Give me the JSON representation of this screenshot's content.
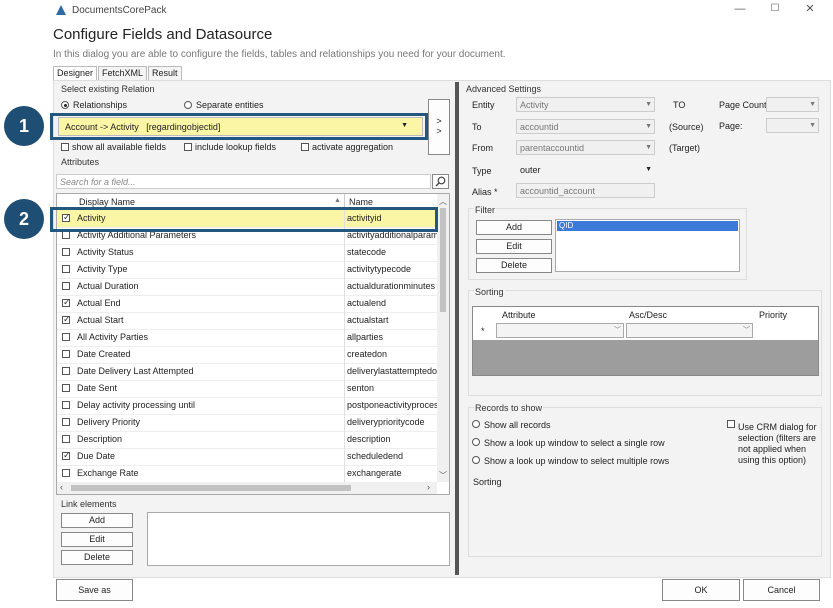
{
  "window": {
    "title": "DocumentsCorePack"
  },
  "dialog": {
    "title": "Configure Fields and Datasource",
    "subtitle": "In this dialog you are able to configure the fields, tables and relationships you need for your document."
  },
  "tabs": [
    "Designer",
    "FetchXML",
    "Result"
  ],
  "relation": {
    "group_label": "Select existing Relation",
    "radio_relationships": "Relationships",
    "radio_separate": "Separate entities",
    "selected": "Account -> Activity   [regardingobjectid]",
    "side_button": ">\n>",
    "chk_show_all": "show all available fields",
    "chk_lookup": "include lookup fields",
    "chk_aggregation": "activate aggregation"
  },
  "attributes": {
    "group_label": "Attributes",
    "search_placeholder": "Search for a field...",
    "col_display": "Display Name",
    "col_name": "Name",
    "rows": [
      {
        "display": "Activity",
        "name": "activityid",
        "checked": true
      },
      {
        "display": "Activity Additional Parameters",
        "name": "activityadditionalparams",
        "checked": false
      },
      {
        "display": "Activity Status",
        "name": "statecode",
        "checked": false
      },
      {
        "display": "Activity Type",
        "name": "activitytypecode",
        "checked": false
      },
      {
        "display": "Actual Duration",
        "name": "actualdurationminutes",
        "checked": false
      },
      {
        "display": "Actual End",
        "name": "actualend",
        "checked": true
      },
      {
        "display": "Actual Start",
        "name": "actualstart",
        "checked": true
      },
      {
        "display": "All Activity Parties",
        "name": "allparties",
        "checked": false
      },
      {
        "display": "Date Created",
        "name": "createdon",
        "checked": false
      },
      {
        "display": "Date Delivery Last Attempted",
        "name": "deliverylastattemptedon",
        "checked": false
      },
      {
        "display": "Date Sent",
        "name": "senton",
        "checked": false
      },
      {
        "display": "Delay activity processing until",
        "name": "postponeactivityprocessinguntil",
        "checked": false
      },
      {
        "display": "Delivery Priority",
        "name": "deliveryprioritycode",
        "checked": false
      },
      {
        "display": "Description",
        "name": "description",
        "checked": false
      },
      {
        "display": "Due Date",
        "name": "scheduledend",
        "checked": true
      },
      {
        "display": "Exchange Rate",
        "name": "exchangerate",
        "checked": false
      }
    ]
  },
  "link_elements": {
    "group_label": "Link elements",
    "add": "Add",
    "edit": "Edit",
    "delete": "Delete"
  },
  "advanced": {
    "group_label": "Advanced Settings",
    "entity_label": "Entity",
    "entity_value": "Activity",
    "to_label": "To",
    "to_value": "accountid",
    "to_hint": "(Source)",
    "from_label": "From",
    "from_value": "parentaccountid",
    "from_hint": "(Target)",
    "type_label": "Type",
    "type_value": "outer",
    "alias_label": "Alias *",
    "alias_value": "accountid_account",
    "TO_label": "TO",
    "page_count_label": "Page Count:",
    "page_label": "Page:"
  },
  "filter": {
    "group_label": "Filter",
    "add": "Add",
    "edit": "Edit",
    "delete": "Delete",
    "item": "QID"
  },
  "sorting": {
    "group_label": "Sorting",
    "col_attribute": "Attribute",
    "col_ascdesc": "Asc/Desc",
    "col_priority": "Priority",
    "row_marker": "*"
  },
  "records": {
    "group_label": "Records to show",
    "opt_all": "Show all records",
    "opt_single": "Show a look up window to select a single row",
    "opt_multiple": "Show a look up window to select multiple rows",
    "use_crm": "Use CRM dialog for selection (filters are not applied when using this option)",
    "sorting_label": "Sorting"
  },
  "footer": {
    "save_as": "Save as",
    "ok": "OK",
    "cancel": "Cancel"
  },
  "badges": [
    "1",
    "2"
  ],
  "colors": {
    "highlight": "#24577d",
    "badge": "#1e4e74",
    "selected_row": "#fbf6a6",
    "filter_selected": "#3b7ad8"
  }
}
